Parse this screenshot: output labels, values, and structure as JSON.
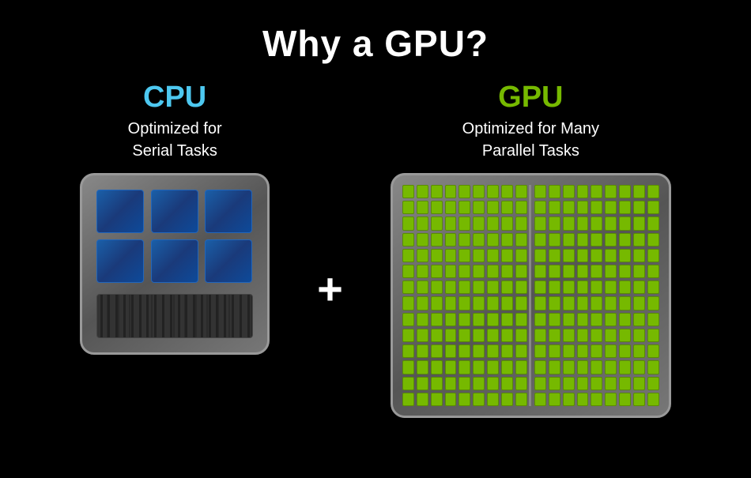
{
  "page": {
    "title": "Why a GPU?",
    "background": "#000000"
  },
  "cpu": {
    "label": "CPU",
    "subtitle_line1": "Optimized for",
    "subtitle_line2": "Serial Tasks",
    "core_count": 6,
    "color": "#4dc8f0"
  },
  "gpu": {
    "label": "GPU",
    "subtitle_line1": "Optimized for Many",
    "subtitle_line2": "Parallel Tasks",
    "core_count": 252,
    "color": "#76b900"
  },
  "plus_symbol": "+",
  "colors": {
    "cpu_accent": "#4dc8f0",
    "gpu_accent": "#76b900",
    "text_white": "#ffffff",
    "background": "#000000",
    "chip_border": "#999999"
  }
}
